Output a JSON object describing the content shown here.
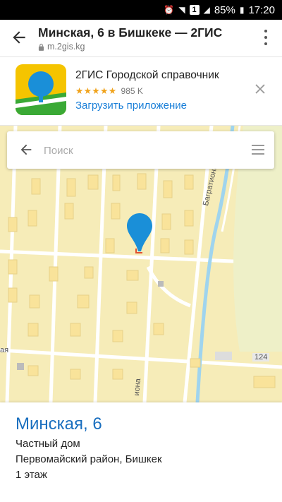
{
  "status_bar": {
    "sim_badge": "1",
    "battery": "85%",
    "time": "17:20"
  },
  "browser": {
    "title": "Минская, 6 в Бишкеке — 2ГИС",
    "url": "m.2gis.kg"
  },
  "app_banner": {
    "name": "2ГИС Городской справочник",
    "stars": "★★★★★",
    "rating_value": 4.5,
    "reviews": "985 K",
    "download_label": "Загрузить приложение",
    "logo_colors": [
      "#f5c400",
      "#1a8fd8",
      "#3aa935"
    ]
  },
  "search": {
    "placeholder": "Поиск"
  },
  "map": {
    "street_labels": [
      "Багратиона",
      "ая",
      "иона"
    ],
    "road_number": "124",
    "marker_color": "#1a8fd8"
  },
  "place": {
    "title": "Минская, 6",
    "type": "Частный дом",
    "address": "Первомайский район, Бишкек",
    "floor": "1 этаж"
  },
  "colors": {
    "accent": "#1a7fd8",
    "map_bg": "#f6ecb8",
    "star": "#f0a21a"
  }
}
